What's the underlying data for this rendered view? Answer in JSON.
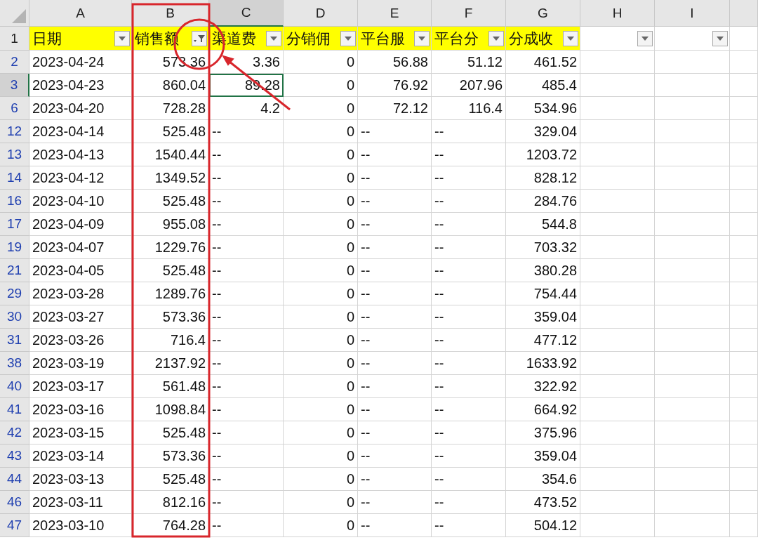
{
  "columns": [
    {
      "letter": "A",
      "header": "日期",
      "selected": false,
      "filtered": false
    },
    {
      "letter": "B",
      "header": "销售额",
      "selected": false,
      "filtered": true
    },
    {
      "letter": "C",
      "header": "渠道费",
      "selected": true,
      "filtered": false
    },
    {
      "letter": "D",
      "header": "分销佣",
      "selected": false,
      "filtered": false
    },
    {
      "letter": "E",
      "header": "平台服",
      "selected": false,
      "filtered": false
    },
    {
      "letter": "F",
      "header": "平台分",
      "selected": false,
      "filtered": false
    },
    {
      "letter": "G",
      "header": "分成收",
      "selected": false,
      "filtered": false
    },
    {
      "letter": "H",
      "selected": false,
      "filtered": false
    },
    {
      "letter": "I",
      "selected": false,
      "filtered": false
    }
  ],
  "header_row": {
    "number": "1",
    "selected": false
  },
  "rows": [
    {
      "number": "2",
      "selected": false,
      "cells": [
        "2023-04-24",
        "573.36",
        "3.36",
        "0",
        "56.88",
        "51.12",
        "461.52"
      ]
    },
    {
      "number": "3",
      "selected": true,
      "cells": [
        "2023-04-23",
        "860.04",
        "89.28",
        "0",
        "76.92",
        "207.96",
        "485.4"
      ]
    },
    {
      "number": "6",
      "selected": false,
      "cells": [
        "2023-04-20",
        "728.28",
        "4.2",
        "0",
        "72.12",
        "116.4",
        "534.96"
      ]
    },
    {
      "number": "12",
      "selected": false,
      "cells": [
        "2023-04-14",
        "525.48",
        "--",
        "0",
        "--",
        "--",
        "329.04"
      ]
    },
    {
      "number": "13",
      "selected": false,
      "cells": [
        "2023-04-13",
        "1540.44",
        "--",
        "0",
        "--",
        "--",
        "1203.72"
      ]
    },
    {
      "number": "14",
      "selected": false,
      "cells": [
        "2023-04-12",
        "1349.52",
        "--",
        "0",
        "--",
        "--",
        "828.12"
      ]
    },
    {
      "number": "16",
      "selected": false,
      "cells": [
        "2023-04-10",
        "525.48",
        "--",
        "0",
        "--",
        "--",
        "284.76"
      ]
    },
    {
      "number": "17",
      "selected": false,
      "cells": [
        "2023-04-09",
        "955.08",
        "--",
        "0",
        "--",
        "--",
        "544.8"
      ]
    },
    {
      "number": "19",
      "selected": false,
      "cells": [
        "2023-04-07",
        "1229.76",
        "--",
        "0",
        "--",
        "--",
        "703.32"
      ]
    },
    {
      "number": "21",
      "selected": false,
      "cells": [
        "2023-04-05",
        "525.48",
        "--",
        "0",
        "--",
        "--",
        "380.28"
      ]
    },
    {
      "number": "29",
      "selected": false,
      "cells": [
        "2023-03-28",
        "1289.76",
        "--",
        "0",
        "--",
        "--",
        "754.44"
      ]
    },
    {
      "number": "30",
      "selected": false,
      "cells": [
        "2023-03-27",
        "573.36",
        "--",
        "0",
        "--",
        "--",
        "359.04"
      ]
    },
    {
      "number": "31",
      "selected": false,
      "cells": [
        "2023-03-26",
        "716.4",
        "--",
        "0",
        "--",
        "--",
        "477.12"
      ]
    },
    {
      "number": "38",
      "selected": false,
      "cells": [
        "2023-03-19",
        "2137.92",
        "--",
        "0",
        "--",
        "--",
        "1633.92"
      ]
    },
    {
      "number": "40",
      "selected": false,
      "cells": [
        "2023-03-17",
        "561.48",
        "--",
        "0",
        "--",
        "--",
        "322.92"
      ]
    },
    {
      "number": "41",
      "selected": false,
      "cells": [
        "2023-03-16",
        "1098.84",
        "--",
        "0",
        "--",
        "--",
        "664.92"
      ]
    },
    {
      "number": "42",
      "selected": false,
      "cells": [
        "2023-03-15",
        "525.48",
        "--",
        "0",
        "--",
        "--",
        "375.96"
      ]
    },
    {
      "number": "43",
      "selected": false,
      "cells": [
        "2023-03-14",
        "573.36",
        "--",
        "0",
        "--",
        "--",
        "359.04"
      ]
    },
    {
      "number": "44",
      "selected": false,
      "cells": [
        "2023-03-13",
        "525.48",
        "--",
        "0",
        "--",
        "--",
        "354.6"
      ]
    },
    {
      "number": "46",
      "selected": false,
      "cells": [
        "2023-03-11",
        "812.16",
        "--",
        "0",
        "--",
        "--",
        "473.52"
      ]
    },
    {
      "number": "47",
      "selected": false,
      "cells": [
        "2023-03-10",
        "764.28",
        "--",
        "0",
        "--",
        "--",
        "504.12"
      ]
    }
  ]
}
